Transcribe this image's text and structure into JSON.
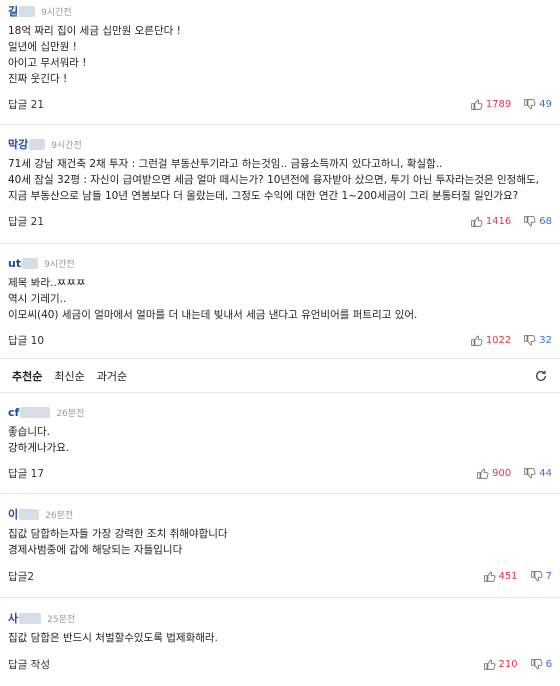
{
  "comments": [
    {
      "author": "길",
      "time": "9시간전",
      "lines": [
        "18억 짜리 집이 세금 십만원 오른단다 !",
        "일년에 십만원 !",
        "아이고 무서워라 !",
        "진짜 웃긴다 !"
      ],
      "reply_label": "답글",
      "reply_count": "21",
      "likes": "1789",
      "dislikes": "49"
    },
    {
      "author": "막강",
      "time": "9시간전",
      "lines": [
        "71세 강남 재건축 2채 투자 : 그런걸 부동산투기라고 하는것임.. 금융소득까지 있다고하니, 확실함..",
        "40세 잠실 32평 : 자신이 급여받으면 세금 얼마 떼시는가? 10년전에 융자받아 샀으면, 투기 아닌 투자라는것은 인정해도,",
        "지금 부동산으로 남들 10년 연봉보다 더 올랐는데, 그정도 수익에 대한 연간 1~200세금이 그리 분통터질 일인가요?"
      ],
      "reply_label": "답글",
      "reply_count": "21",
      "likes": "1416",
      "dislikes": "68"
    },
    {
      "author": "ut",
      "time": "9시간전",
      "lines": [
        "제목 봐라..ㅉㅉㅉ",
        "역시 기레기..",
        "이모씨(40) 세금이 얼마에서 얼마를 더 내는데 빚내서 세금 낸다고 유언비어를 퍼트리고 있어."
      ],
      "reply_label": "답글",
      "reply_count": "10",
      "likes": "1022",
      "dislikes": "32"
    },
    {
      "author": "cf",
      "time": "26분전",
      "lines": [
        "좋습니다.",
        "강하게나가요."
      ],
      "reply_label": "답글",
      "reply_count": "17",
      "likes": "900",
      "dislikes": "44"
    },
    {
      "author": "이",
      "time": "26분전",
      "lines": [
        "집값 담합하는자들 가장 강력한 조치 취해야합니다",
        "경제사범중에 갑에 해당되는 자들입니다"
      ],
      "reply_label": "답글",
      "reply_count": "2",
      "likes": "451",
      "dislikes": "7"
    },
    {
      "author": "사",
      "time": "25분전",
      "lines": [
        "집값 담합은 반드시 처벌할수있도록 법제화해라."
      ],
      "reply_label": "답글 작성",
      "reply_count": "",
      "likes": "210",
      "dislikes": "6"
    }
  ],
  "sort": {
    "options": [
      "추천순",
      "최신순",
      "과거순"
    ],
    "active": "추천순"
  },
  "icons": {
    "like": "thumbs-up-icon",
    "dislike": "thumbs-down-icon",
    "refresh": "refresh-icon"
  }
}
